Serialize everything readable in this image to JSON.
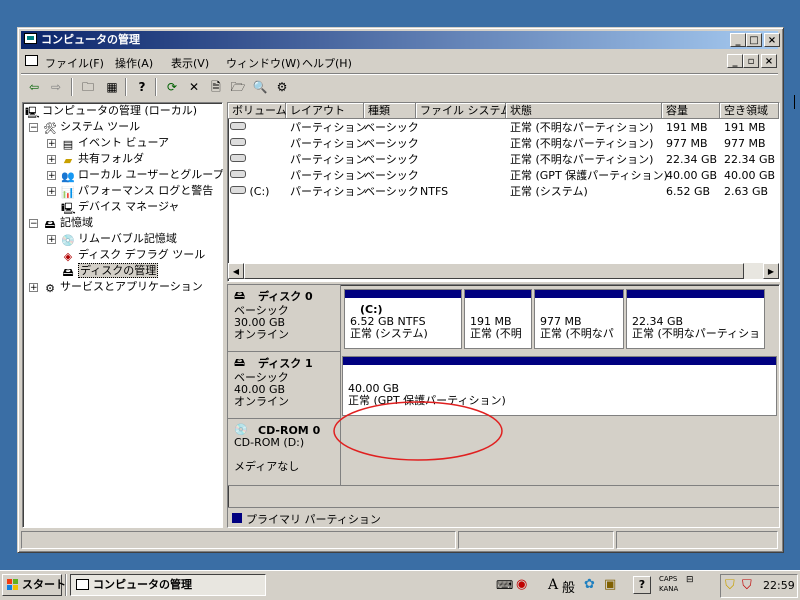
{
  "window": {
    "title": "コンピュータの管理",
    "minimize": "_",
    "maximize": "□",
    "close": "×"
  },
  "menu": {
    "items": [
      "ファイル(F)",
      "操作(A)",
      "表示(V)",
      "ウィンドウ(W)",
      "ヘルプ(H)"
    ]
  },
  "tree": {
    "root": "コンピュータの管理 (ローカル)",
    "system_tools": "システム ツール",
    "event_viewer": "イベント ビューア",
    "shared_folders": "共有フォルダ",
    "local_users": "ローカル ユーザーとグループ",
    "performance": "パフォーマンス ログと警告",
    "device_manager": "デバイス マネージャ",
    "storage": "記憶域",
    "removable": "リムーバブル記憶域",
    "defrag": "ディスク デフラグ ツール",
    "disk_management": "ディスクの管理",
    "services": "サービスとアプリケーション"
  },
  "volume_list": {
    "columns": [
      "ボリューム",
      "レイアウト",
      "種類",
      "ファイル システム",
      "状態",
      "容量",
      "空き領域"
    ],
    "rows": [
      {
        "volume": "",
        "layout": "パーティション",
        "type": "ベーシック",
        "fs": "",
        "status": "正常 (不明なパーティション)",
        "capacity": "191 MB",
        "free": "191 MB"
      },
      {
        "volume": "",
        "layout": "パーティション",
        "type": "ベーシック",
        "fs": "",
        "status": "正常 (不明なパーティション)",
        "capacity": "977 MB",
        "free": "977 MB"
      },
      {
        "volume": "",
        "layout": "パーティション",
        "type": "ベーシック",
        "fs": "",
        "status": "正常 (不明なパーティション)",
        "capacity": "22.34 GB",
        "free": "22.34 GB"
      },
      {
        "volume": "",
        "layout": "パーティション",
        "type": "ベーシック",
        "fs": "",
        "status": "正常 (GPT 保護パーティション)",
        "capacity": "40.00 GB",
        "free": "40.00 GB"
      },
      {
        "volume": "(C:)",
        "layout": "パーティション",
        "type": "ベーシック",
        "fs": "NTFS",
        "status": "正常 (システム)",
        "capacity": "6.52 GB",
        "free": "2.63 GB"
      }
    ]
  },
  "disks": {
    "disk0": {
      "name": "ディスク 0",
      "kind": "ベーシック",
      "size": "30.00 GB",
      "state": "オンライン",
      "partitions": [
        {
          "line1": "(C:)",
          "line2": "6.52 GB NTFS",
          "line3": "正常 (システム)"
        },
        {
          "line1": "",
          "line2": "191 MB",
          "line3": "正常 (不明"
        },
        {
          "line1": "",
          "line2": "977 MB",
          "line3": "正常 (不明なパ"
        },
        {
          "line1": "",
          "line2": "22.34 GB",
          "line3": "正常 (不明なパーティショ"
        }
      ]
    },
    "disk1": {
      "name": "ディスク 1",
      "kind": "ベーシック",
      "size": "40.00 GB",
      "state": "オンライン",
      "partition": {
        "line1": "40.00 GB",
        "line2": "正常 (GPT 保護パーティション)"
      }
    },
    "cdrom0": {
      "name": "CD-ROM 0",
      "drive": "CD-ROM (D:)",
      "state": "メディアなし"
    }
  },
  "legend": {
    "primary": "プライマリ パーティション",
    "primary_color": "#000080"
  },
  "annotation_color": "#e02020",
  "taskbar": {
    "start": "スタート",
    "task": "コンピュータの管理",
    "ime_a": "A",
    "ime_mode": "般",
    "caps": "CAPS",
    "kana": "KANA",
    "clock": "22:59"
  }
}
